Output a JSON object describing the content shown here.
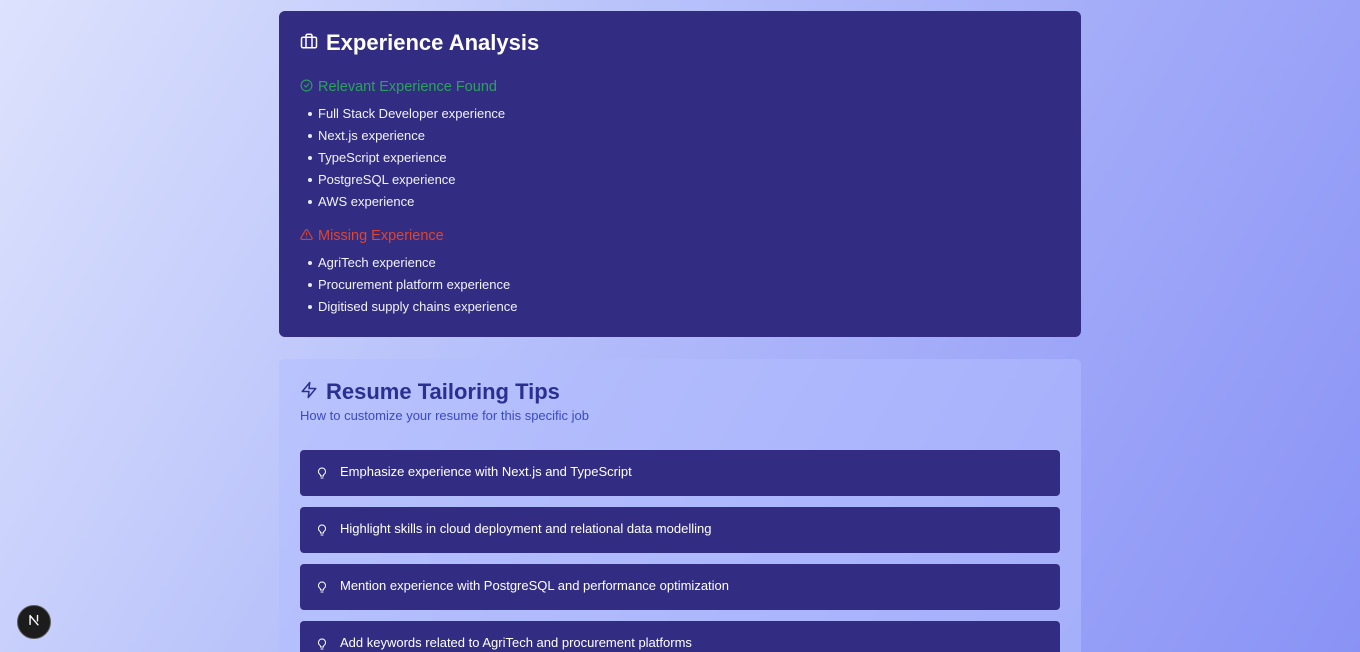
{
  "experience": {
    "title": "Experience Analysis",
    "found_heading": "Relevant Experience Found",
    "found_items": [
      "Full Stack Developer experience",
      "Next.js experience",
      "TypeScript experience",
      "PostgreSQL experience",
      "AWS experience"
    ],
    "missing_heading": "Missing Experience",
    "missing_items": [
      "AgriTech experience",
      "Procurement platform experience",
      "Digitised supply chains experience"
    ]
  },
  "tips": {
    "title": "Resume Tailoring Tips",
    "subtitle": "How to customize your resume for this specific job",
    "items": [
      "Emphasize experience with Next.js and TypeScript",
      "Highlight skills in cloud deployment and relational data modelling",
      "Mention experience with PostgreSQL and performance optimization",
      "Add keywords related to AgriTech and procurement platforms"
    ]
  },
  "icons": {
    "experience": "briefcase-icon",
    "found": "check-circle-icon",
    "missing": "warning-triangle-icon",
    "tips": "lightning-icon",
    "tip": "lightbulb-icon",
    "badge": "nextjs-logo-icon"
  },
  "colors": {
    "card_dark": "#322d82",
    "found": "#2aa35a",
    "missing": "#e0452d",
    "tips_title": "#2b2f92"
  }
}
